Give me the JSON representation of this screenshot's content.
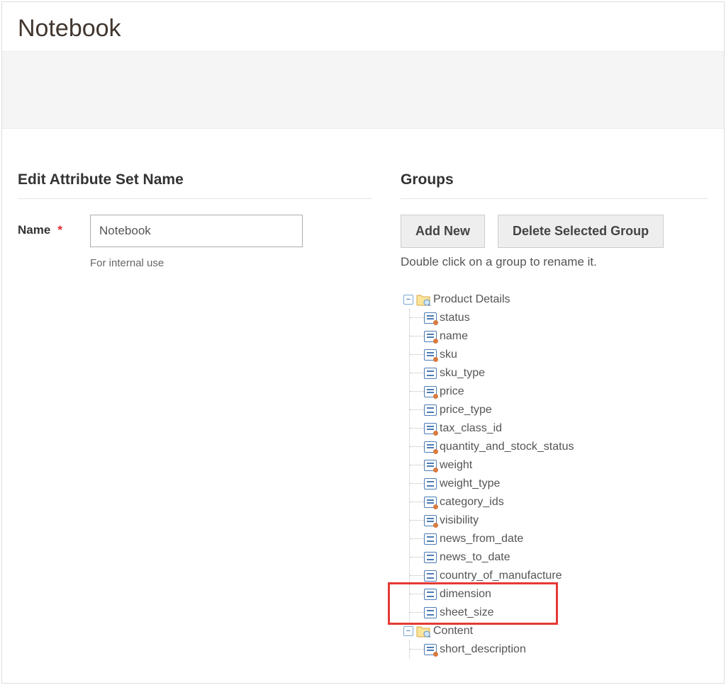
{
  "page_title": "Notebook",
  "left": {
    "section_title": "Edit Attribute Set Name",
    "name_label": "Name",
    "name_value": "Notebook",
    "name_note": "For internal use"
  },
  "right": {
    "section_title": "Groups",
    "add_new_label": "Add New",
    "delete_group_label": "Delete Selected Group",
    "hint": "Double click on a group to rename it.",
    "groups": [
      {
        "name": "Product Details",
        "expanded": true,
        "attributes": [
          {
            "name": "status",
            "system": true
          },
          {
            "name": "name",
            "system": true
          },
          {
            "name": "sku",
            "system": true
          },
          {
            "name": "sku_type",
            "system": false
          },
          {
            "name": "price",
            "system": true
          },
          {
            "name": "price_type",
            "system": false
          },
          {
            "name": "tax_class_id",
            "system": true
          },
          {
            "name": "quantity_and_stock_status",
            "system": true
          },
          {
            "name": "weight",
            "system": true
          },
          {
            "name": "weight_type",
            "system": false
          },
          {
            "name": "category_ids",
            "system": true
          },
          {
            "name": "visibility",
            "system": true
          },
          {
            "name": "news_from_date",
            "system": false
          },
          {
            "name": "news_to_date",
            "system": false
          },
          {
            "name": "country_of_manufacture",
            "system": false
          },
          {
            "name": "dimension",
            "system": false,
            "highlight": true
          },
          {
            "name": "sheet_size",
            "system": false,
            "highlight": true
          }
        ]
      },
      {
        "name": "Content",
        "expanded": true,
        "attributes": [
          {
            "name": "short_description",
            "system": true
          }
        ]
      }
    ]
  }
}
